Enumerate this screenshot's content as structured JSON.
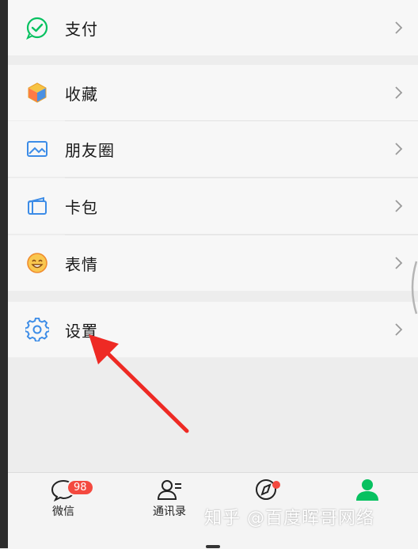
{
  "menu": {
    "pay": {
      "label": "支付"
    },
    "favorites": {
      "label": "收藏"
    },
    "moments": {
      "label": "朋友圈"
    },
    "cards": {
      "label": "卡包"
    },
    "stickers": {
      "label": "表情"
    },
    "settings": {
      "label": "设置"
    }
  },
  "tabbar": {
    "chats": {
      "label": "微信",
      "badge": "98"
    },
    "contacts": {
      "label": "通讯录"
    },
    "discover": {
      "label": "发现"
    }
  },
  "watermark": "知乎 @百度晖哥网络",
  "colors": {
    "accent_green": "#07c160",
    "badge_red": "#f4493f",
    "arrow_red": "#ee2a24"
  }
}
